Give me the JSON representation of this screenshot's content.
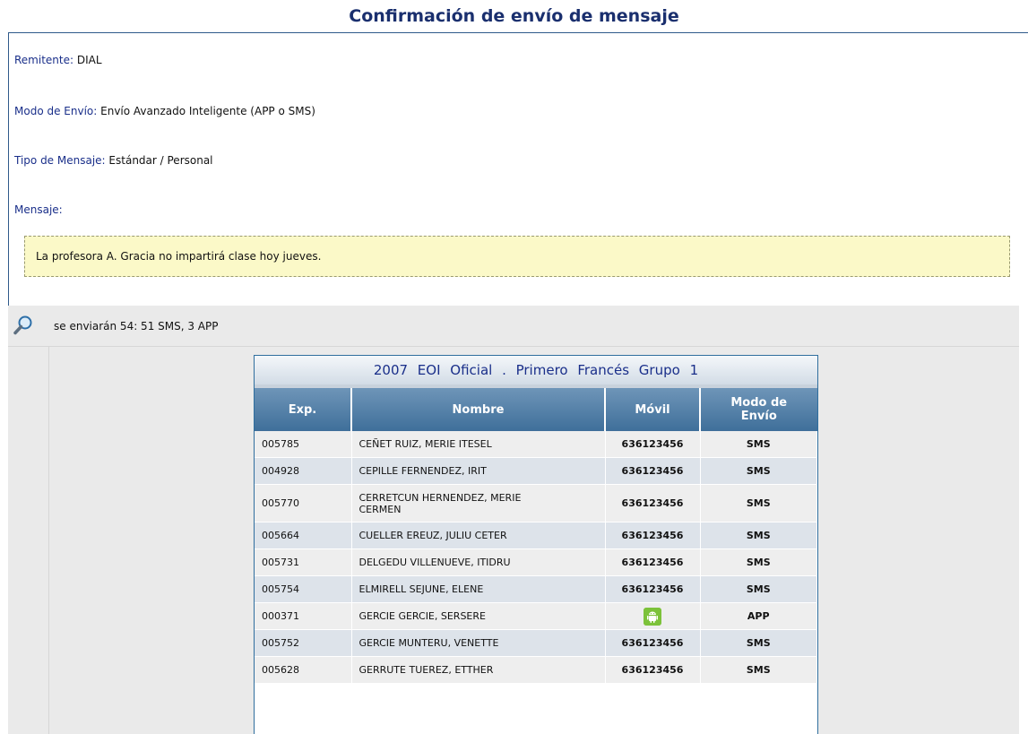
{
  "title": "Confirmación de envío de mensaje",
  "fields": {
    "remitente_label": "Remitente:",
    "remitente_value": "DIAL",
    "modo_label": "Modo de Envío:",
    "modo_value": "Envío Avanzado Inteligente (APP o SMS)",
    "tipo_label": "Tipo de Mensaje:",
    "tipo_value": "Estándar / Personal",
    "mensaje_label": "Mensaje:",
    "mensaje_text": "La profesora A. Gracia no impartirá clase hoy jueves."
  },
  "summary": {
    "text": "se enviarán 54: 51 SMS, 3 APP",
    "icon": "search-icon"
  },
  "table": {
    "group_title": "2007 EOI Oficial . Primero Francés Grupo 1",
    "headers": {
      "exp": "Exp.",
      "nombre": "Nombre",
      "movil": "Móvil",
      "modo_line1": "Modo de",
      "modo_line2": "Envío"
    },
    "rows": [
      {
        "exp": "005785",
        "nombre": "CEÑET RUIZ, MERIE ITESEL",
        "movil": "636123456",
        "modo": "SMS"
      },
      {
        "exp": "004928",
        "nombre": "CEPILLE FERNENDEZ, IRIT",
        "movil": "636123456",
        "modo": "SMS"
      },
      {
        "exp": "005770",
        "nombre_line1": "CERRETCUN HERNENDEZ, MERIE",
        "nombre_line2": "CERMEN",
        "movil": "636123456",
        "modo": "SMS"
      },
      {
        "exp": "005664",
        "nombre": "CUELLER EREUZ, JULIU CETER",
        "movil": "636123456",
        "modo": "SMS"
      },
      {
        "exp": "005731",
        "nombre": "DELGEDU VILLENUEVE, ITIDRU",
        "movil": "636123456",
        "modo": "SMS"
      },
      {
        "exp": "005754",
        "nombre": "ELMIRELL SEJUNE, ELENE",
        "movil": "636123456",
        "modo": "SMS"
      },
      {
        "exp": "000371",
        "nombre": "GERCIE GERCIE, SERSERE",
        "movil_icon": "android-icon",
        "modo": "APP"
      },
      {
        "exp": "005752",
        "nombre": "GERCIE MUNTERU, VENETTE",
        "movil": "636123456",
        "modo": "SMS"
      },
      {
        "exp": "005628",
        "nombre": "GERRUTE TUEREZ, ETTHER",
        "movil": "636123456",
        "modo": "SMS"
      }
    ]
  },
  "colors": {
    "label": "#1a2f8a",
    "header_bg": "#4f7fa8",
    "message_bg": "#fbf9c8",
    "android": "#7cc23a"
  }
}
